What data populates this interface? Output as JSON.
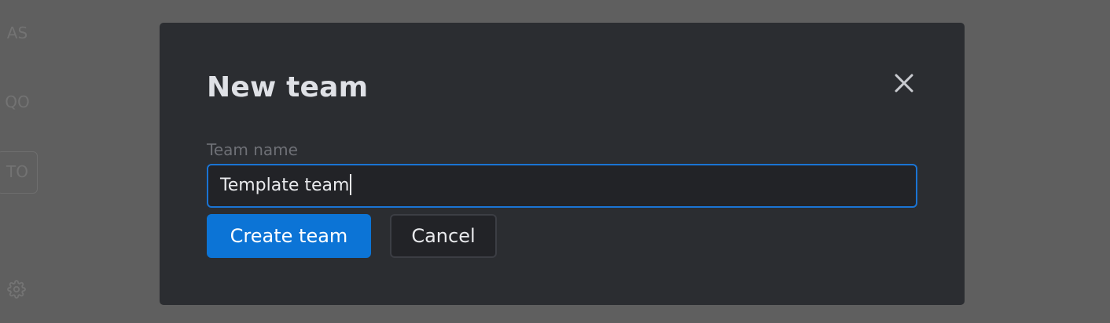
{
  "sidebar": {
    "teams": [
      {
        "initials": "AS"
      },
      {
        "initials": "QO"
      },
      {
        "initials": "TO",
        "active": true
      }
    ],
    "settings_icon": "gear-icon"
  },
  "modal": {
    "title": "New team",
    "close_icon": "close-icon",
    "field": {
      "label": "Team name",
      "value": "Template team"
    },
    "buttons": {
      "create_label": "Create team",
      "cancel_label": "Cancel"
    }
  },
  "colors": {
    "backdrop": "#5f5f5f",
    "modal_bg": "#2b2d31",
    "accent": "#0c74d6",
    "input_border": "#1a74d4"
  }
}
